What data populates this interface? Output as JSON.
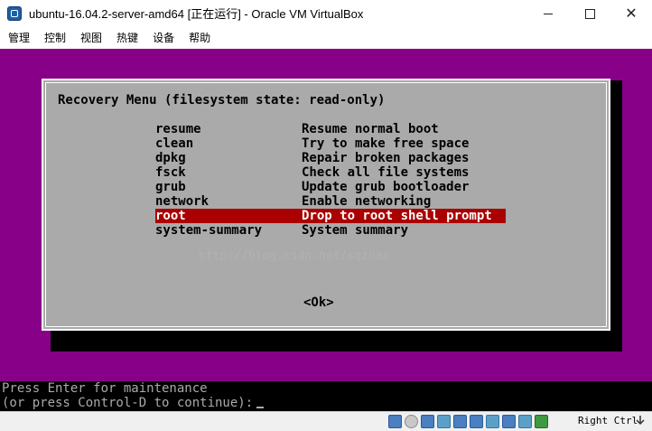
{
  "window": {
    "title": "ubuntu-16.04.2-server-amd64 [正在运行] - Oracle VM VirtualBox",
    "minimize_glyph": "—",
    "maximize_glyph": "☐",
    "close_glyph": "✕"
  },
  "menubar": {
    "items": [
      "管理",
      "控制",
      "视图",
      "热键",
      "设备",
      "帮助"
    ]
  },
  "recovery": {
    "title": "Recovery Menu (filesystem state: read-only)",
    "items": [
      {
        "key": "resume",
        "desc": "Resume normal boot"
      },
      {
        "key": "clean",
        "desc": "Try to make free space"
      },
      {
        "key": "dpkg",
        "desc": "Repair broken packages"
      },
      {
        "key": "fsck",
        "desc": "Check all file systems"
      },
      {
        "key": "grub",
        "desc": "Update grub bootloader"
      },
      {
        "key": "network",
        "desc": "Enable networking"
      },
      {
        "key": "root",
        "desc": "Drop to root shell prompt"
      },
      {
        "key": "system-summary",
        "desc": "System summary"
      }
    ],
    "selected_index": 6,
    "ok_label": "<Ok>",
    "watermark": "http://blog.csdn.net/sqzhao"
  },
  "console": {
    "line1": "Press Enter for maintenance",
    "line2": "(or press Control-D to continue):"
  },
  "statusbar": {
    "icons": [
      "hard-disk-icon",
      "optical-drive-icon",
      "network-icon",
      "usb-icon",
      "shared-folders-icon",
      "display-icon",
      "video-capture-icon",
      "recording-icon",
      "cpu-icon",
      "mouse-integration-icon"
    ],
    "host_key": "Right Ctrl"
  },
  "colors": {
    "vm_background": "#880088",
    "dialog_background": "#aaaaaa",
    "selection": "#aa0000",
    "console_background": "#000000"
  }
}
